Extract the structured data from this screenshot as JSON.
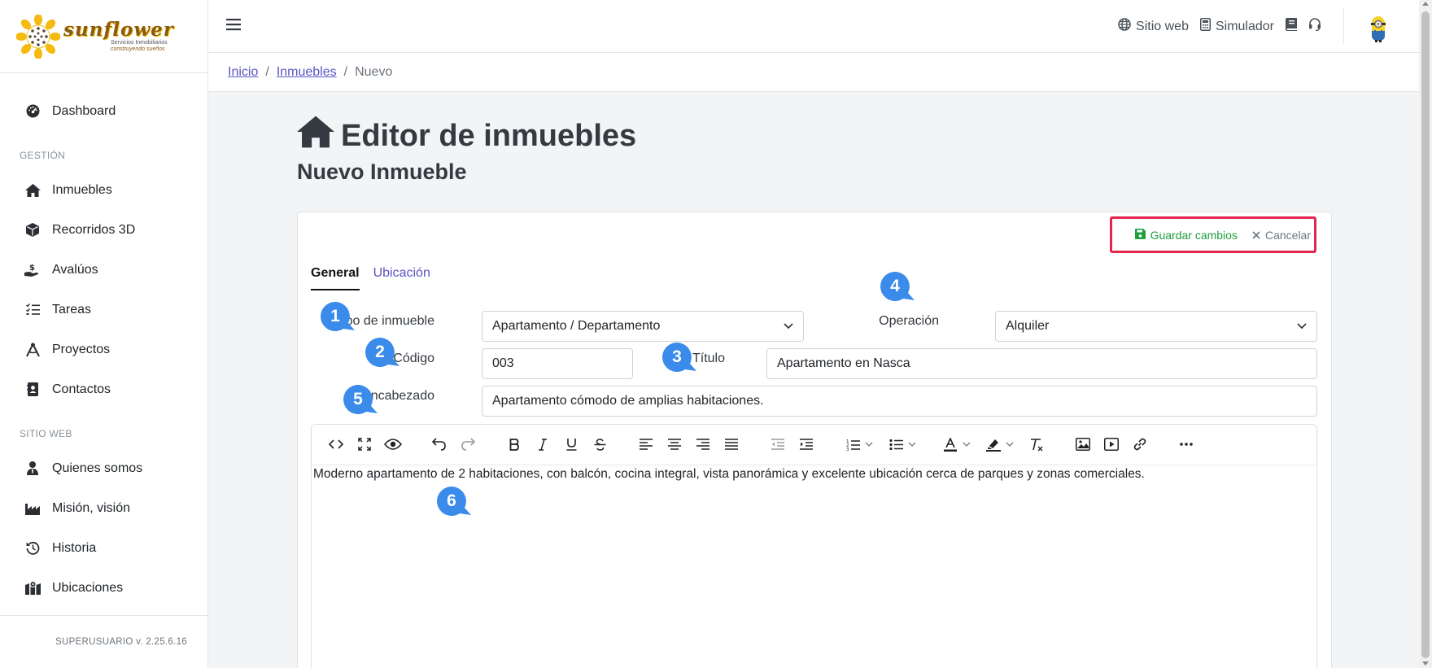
{
  "sidebar": {
    "logo": {
      "word": "sunflower",
      "tagline": "Servicios Inmobiliarios",
      "motto": "construyendo sueños"
    },
    "dashboard": "Dashboard",
    "section_gestion": "GESTIÓN",
    "gestion_items": [
      "Inmuebles",
      "Recorridos 3D",
      "Avalúos",
      "Tareas",
      "Proyectos",
      "Contactos"
    ],
    "section_web": "SITIO WEB",
    "web_items": [
      "Quienes somos",
      "Misión, visión",
      "Historia",
      "Ubicaciones"
    ],
    "version": "SUPERUSUARIO v. 2.25.6.16"
  },
  "topbar": {
    "site_link": "Sitio web",
    "simulator_link": "Simulador"
  },
  "breadcrumb": {
    "home": "Inicio",
    "section": "Inmuebles",
    "current": "Nuevo",
    "sep": "/"
  },
  "page": {
    "title": "Editor de inmuebles",
    "subtitle": "Nuevo Inmueble"
  },
  "actions": {
    "save": "Guardar cambios",
    "cancel": "Cancelar"
  },
  "tabs": [
    "General",
    "Ubicación"
  ],
  "form": {
    "tipo_label": "Tipo de inmueble",
    "tipo_value": "Apartamento / Departamento",
    "operacion_label": "Operación",
    "operacion_value": "Alquiler",
    "codigo_label": "Código",
    "codigo_value": "003",
    "titulo_label": "Título",
    "titulo_value": "Apartamento en Nasca",
    "encabezado_label": "Encabezado",
    "encabezado_value": "Apartamento cómodo de amplias habitaciones.",
    "description": "Moderno apartamento de 2 habitaciones, con balcón, cocina integral, vista panorámica y excelente ubicación cerca de parques y zonas comerciales."
  },
  "callouts": [
    "1",
    "2",
    "3",
    "4",
    "5",
    "6"
  ],
  "colors": {
    "accent": "#5a54c4",
    "save": "#1e9e3e",
    "highlight_border": "#e2264d",
    "callout": "#3b8beb"
  }
}
